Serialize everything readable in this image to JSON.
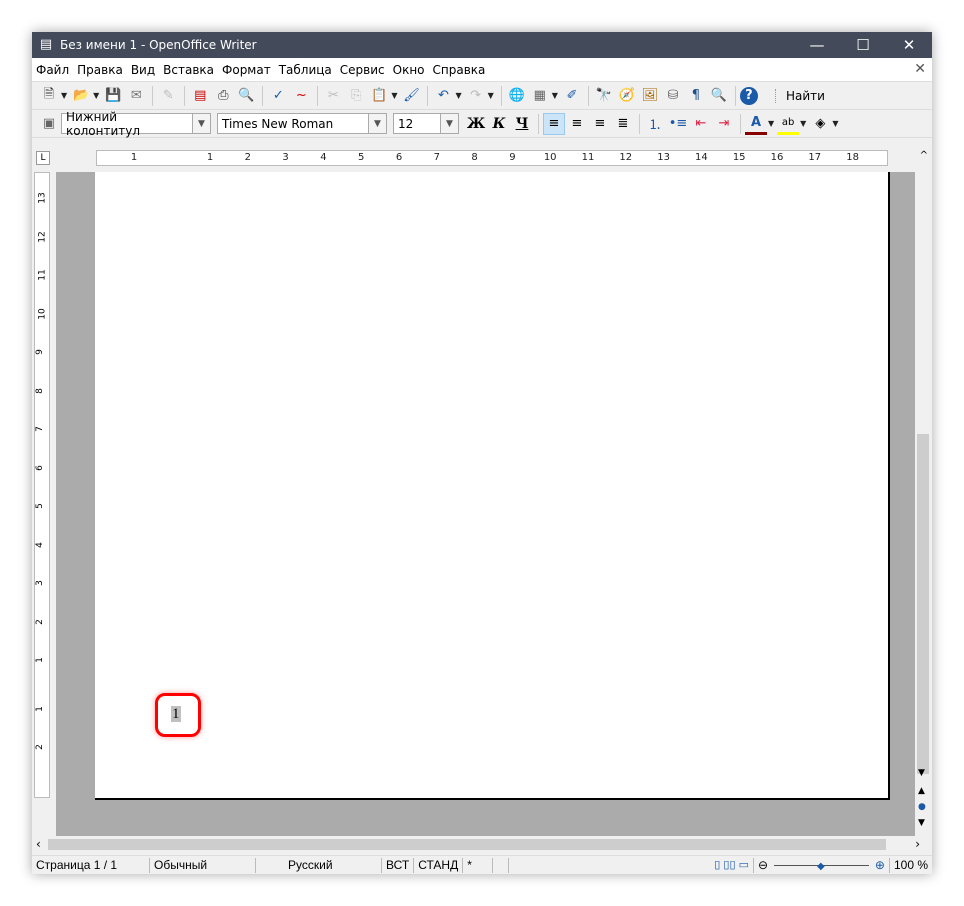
{
  "window": {
    "title": "Без имени 1 - OpenOffice Writer",
    "app_icon": "writer-icon"
  },
  "menu": [
    "Файл",
    "Правка",
    "Вид",
    "Вставка",
    "Формат",
    "Таблица",
    "Сервис",
    "Окно",
    "Справка"
  ],
  "toolbar1": {
    "icons": [
      "new-icon",
      "open-icon",
      "save-icon",
      "email-icon",
      "edit-file-icon",
      "export-pdf-icon",
      "print-icon",
      "print-preview-icon",
      "spellcheck-icon",
      "autospellcheck-icon",
      "cut-icon",
      "copy-icon",
      "paste-icon",
      "clone-format-icon",
      "undo-icon",
      "redo-icon",
      "hyperlink-icon",
      "table-icon",
      "draw-icon",
      "find-replace-icon",
      "navigator-icon",
      "gallery-icon",
      "datasource-icon",
      "formatting-marks-icon",
      "zoom-icon",
      "help-icon"
    ],
    "find_label": "Найти"
  },
  "toolbar2": {
    "paragraph_style": "Нижний колонтитул",
    "font_name": "Times New Roman",
    "font_size": "12",
    "bold": "Ж",
    "italic": "К",
    "underline": "Ч",
    "alignment_active": "left"
  },
  "ruler": {
    "h_labels": [
      "1",
      "1",
      "2",
      "3",
      "4",
      "5",
      "6",
      "7",
      "8",
      "9",
      "10",
      "11",
      "12",
      "13",
      "14",
      "15",
      "16",
      "17",
      "18"
    ],
    "v_labels": [
      "13",
      "12",
      "11",
      "10",
      "9",
      "8",
      "7",
      "6",
      "5",
      "4",
      "3",
      "2",
      "1",
      "1",
      "2"
    ]
  },
  "document": {
    "footer_page_number": "1",
    "highlight_color": "#ff0000"
  },
  "status": {
    "page": "Страница  1 / 1",
    "style": "Обычный",
    "language": "Русский",
    "insert_mode": "ВСТ",
    "selection_mode": "СТАНД",
    "modified": "*",
    "zoom": "100 %",
    "zoom_slider_percent": 100
  }
}
